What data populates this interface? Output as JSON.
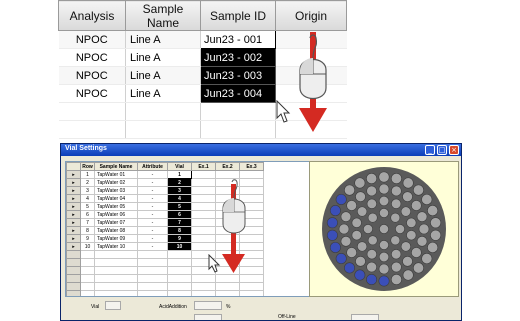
{
  "top_grid": {
    "columns": [
      "Analysis",
      "Sample Name",
      "Sample ID",
      "Origin"
    ],
    "rows": [
      {
        "analysis": "NPOC",
        "sample_name": "Line A",
        "sample_id": "Jun23 - 001"
      },
      {
        "analysis": "NPOC",
        "sample_name": "Line A",
        "sample_id": "Jun23 - 002"
      },
      {
        "analysis": "NPOC",
        "sample_name": "Line A",
        "sample_id": "Jun23 - 003"
      },
      {
        "analysis": "NPOC",
        "sample_name": "Line A",
        "sample_id": "Jun23 - 004"
      }
    ]
  },
  "dialog": {
    "title": "Vial Settings",
    "columns": [
      "Row",
      "Sample Name",
      "Attribute",
      "Vial",
      "Ex.1",
      "Ex.2",
      "Ex.3"
    ],
    "rows": [
      {
        "row": "1",
        "sample_name": "TapWater 01",
        "attribute": "-",
        "vial": "1"
      },
      {
        "row": "2",
        "sample_name": "TapWater 02",
        "attribute": "-",
        "vial": "2"
      },
      {
        "row": "3",
        "sample_name": "TapWater 03",
        "attribute": "-",
        "vial": "3"
      },
      {
        "row": "4",
        "sample_name": "TapWater 04",
        "attribute": "-",
        "vial": "4"
      },
      {
        "row": "5",
        "sample_name": "TapWater 05",
        "attribute": "-",
        "vial": "5"
      },
      {
        "row": "6",
        "sample_name": "TapWater 06",
        "attribute": "-",
        "vial": "6"
      },
      {
        "row": "7",
        "sample_name": "TapWater 07",
        "attribute": "-",
        "vial": "7"
      },
      {
        "row": "8",
        "sample_name": "TapWater 08",
        "attribute": "-",
        "vial": "8"
      },
      {
        "row": "9",
        "sample_name": "TapWater 09",
        "attribute": "-",
        "vial": "9"
      },
      {
        "row": "10",
        "sample_name": "TapWater 10",
        "attribute": "-",
        "vial": "10"
      }
    ],
    "empty_rows": 6,
    "footer": {
      "vial_label": "Vial",
      "acid_addition_label": "AcidAddition",
      "percent_unit": "%",
      "offline_label": "Off-Line"
    },
    "tray": {
      "vial_color": "#a6a6a6",
      "selected_vial_color": "#3b4fb8",
      "tray_color": "#5a5a5a",
      "selected_count": 10
    }
  },
  "colors": {
    "arrow": "#d42a22",
    "selection": "#000000"
  }
}
